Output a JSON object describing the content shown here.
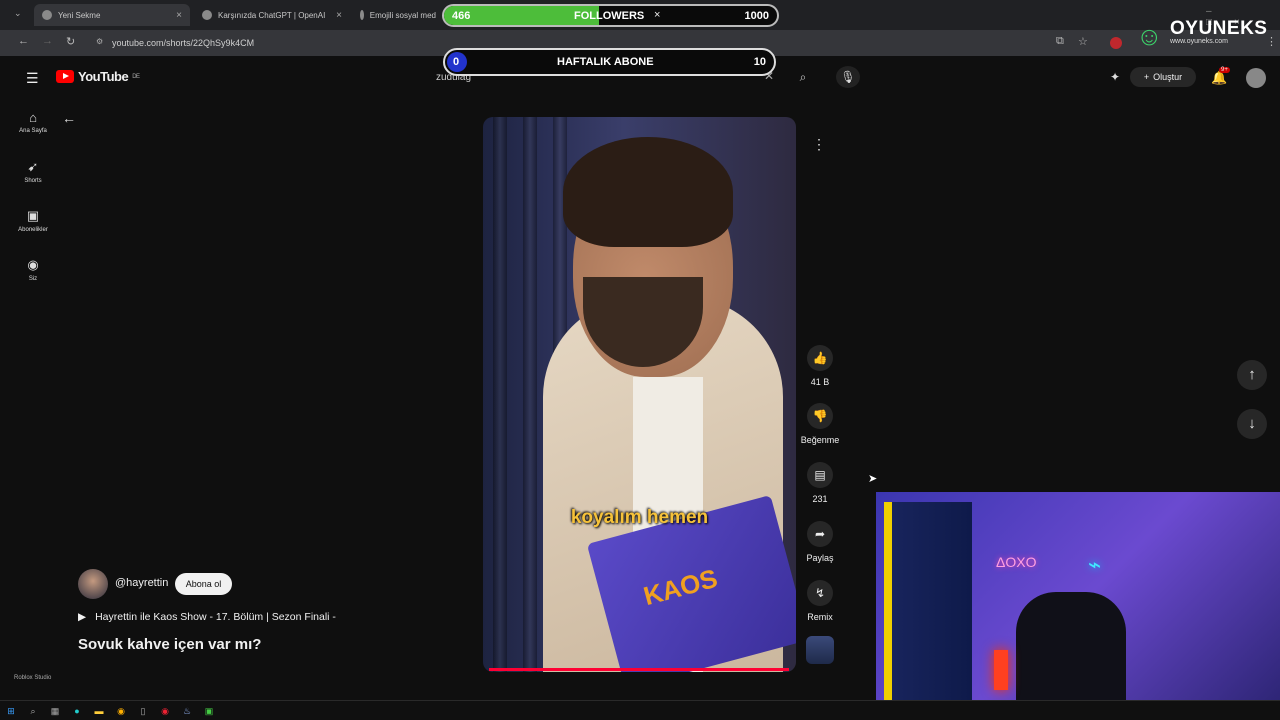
{
  "browser": {
    "tabs": [
      {
        "label": "Yeni Sekme"
      },
      {
        "label": "Karşınızda ChatGPT | OpenAI"
      },
      {
        "label": "Emojili sosyal med"
      }
    ],
    "url": "youtube.com/shorts/22QhSy9k4CM"
  },
  "overlay": {
    "followers_current": "466",
    "followers_label": "FOLLOWERS",
    "followers_goal": "1000",
    "followers_progress": 0.466,
    "weekly_left": "0",
    "weekly_label": "HAFTALIK ABONE",
    "weekly_right": "10",
    "brand_name": "OYUNEKS",
    "brand_url": "www.oyuneks.com"
  },
  "youtube": {
    "logo_text": "YouTube",
    "logo_country": "DE",
    "search_value": "zudulag",
    "create_label": "Oluştur",
    "notif_count": "9+",
    "sidebar": [
      {
        "label": "Ana Sayfa",
        "icon": "home-icon"
      },
      {
        "label": "Shorts",
        "icon": "shorts-icon"
      },
      {
        "label": "Abonelikler",
        "icon": "subscriptions-icon"
      },
      {
        "label": "Siz",
        "icon": "you-icon"
      }
    ]
  },
  "short": {
    "caption": "koyalım hemen",
    "book_text": "KAOS",
    "likes": "41 B",
    "dislike_label": "Beğenme",
    "comments": "231",
    "share_label": "Paylaş",
    "remix_label": "Remix",
    "channel": "@hayrettin",
    "subscribe_label": "Abona ol",
    "playlist": "Hayrettin ile Kaos Show - 17. Bölüm | Sezon Finali -",
    "title": "Sovuk kahve içen var mı?"
  },
  "webcam": {
    "neon1": "ΔOXO"
  },
  "taskbar": {
    "app_label": "Roblox Studio"
  }
}
